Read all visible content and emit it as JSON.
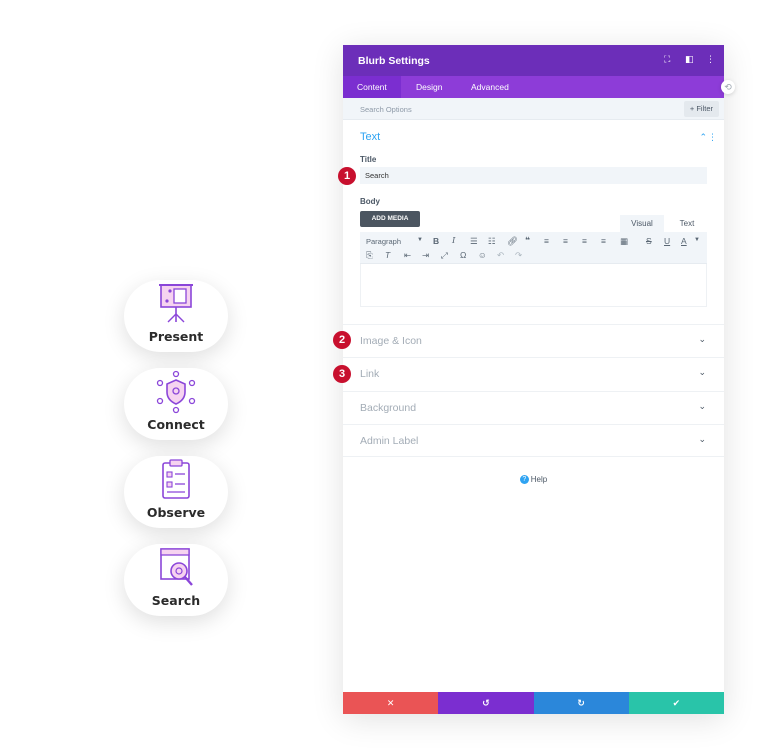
{
  "blurbs": [
    {
      "title": "Present",
      "icon": "presentation-board-icon"
    },
    {
      "title": "Connect",
      "icon": "network-shield-icon"
    },
    {
      "title": "Observe",
      "icon": "clipboard-checklist-icon"
    },
    {
      "title": "Search",
      "icon": "browser-search-icon"
    }
  ],
  "modal": {
    "title": "Blurb Settings",
    "tabs": [
      "Content",
      "Design",
      "Advanced"
    ],
    "search_placeholder": "Search Options",
    "filter_label": "+ Filter",
    "text_section": {
      "title": "Text",
      "title_label": "Title",
      "title_value": "Search",
      "body_label": "Body",
      "add_media_label": "ADD MEDIA",
      "editor_tabs": [
        "Visual",
        "Text"
      ],
      "format_select": "Paragraph"
    },
    "collapsed_sections": [
      "Image & Icon",
      "Link",
      "Background",
      "Admin Label"
    ],
    "help_label": "Help",
    "footer": {
      "cancel_color": "#ea5455",
      "undo_color": "#7b2ed0",
      "redo_color": "#2b87da",
      "save_color": "#29c4a9"
    }
  },
  "markers": [
    "1",
    "2",
    "3"
  ],
  "colors": {
    "header": "#6c2eb9",
    "tabs": "#8d3cd8",
    "accent": "#2ea3f2",
    "marker": "#c8102e",
    "icon_purple": "#8b46d9",
    "icon_pink": "#f089d0"
  }
}
